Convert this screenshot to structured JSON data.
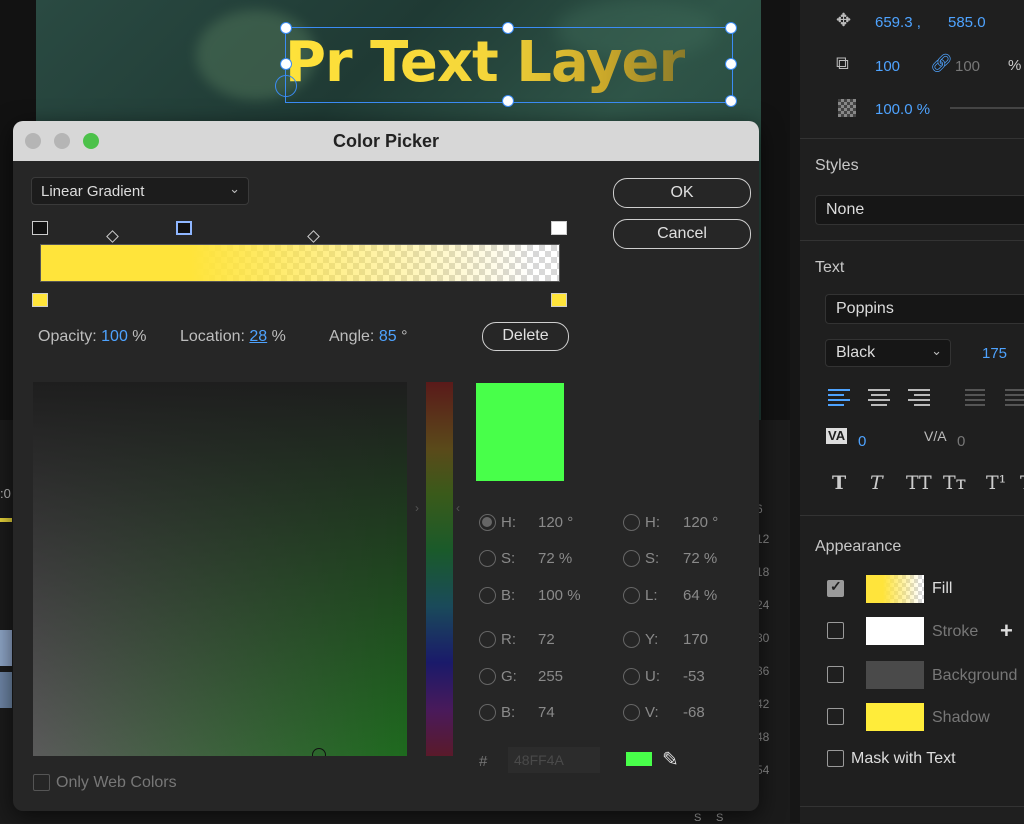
{
  "monitor": {
    "title_text": "Pr Text Layer",
    "timeline_ticks": [
      "6",
      "12",
      "18",
      "24",
      "30",
      "36",
      "42",
      "48",
      "54"
    ],
    "timecode_fragment": ":0",
    "s_labels": [
      "S",
      "S"
    ]
  },
  "right_panel": {
    "position_x": "659.3 ,",
    "position_y": "585.0",
    "scale": "100",
    "scale_link": "100",
    "scale_unit": "%",
    "opacity": "100.0 %",
    "styles_heading": "Styles",
    "styles_value": "None",
    "text_heading": "Text",
    "font": "Poppins",
    "font_style": "Black",
    "font_size": "175",
    "kerning": "0",
    "tracking": "0",
    "text_styles": [
      "T",
      "T",
      "TT",
      "Tт",
      "T¹",
      "T"
    ],
    "appearance_heading": "Appearance",
    "fill_label": "Fill",
    "stroke_label": "Stroke",
    "background_label": "Background",
    "shadow_label": "Shadow",
    "mask_label": "Mask with Text"
  },
  "dialog": {
    "title": "Color Picker",
    "gradient_type": "Linear Gradient",
    "ok_label": "OK",
    "cancel_label": "Cancel",
    "opacity_label": "Opacity:",
    "opacity_value": "100",
    "opacity_unit": "%",
    "location_label": "Location:",
    "location_value": "28",
    "location_unit": "%",
    "angle_label": "Angle:",
    "angle_value": "85",
    "angle_unit": "°",
    "delete_label": "Delete",
    "only_web_colors": "Only Web Colors",
    "hash": "#",
    "hex_value": "48FF4A",
    "new_color": "#48ff4a",
    "gradient_color": "#ffe43b",
    "fields_left": [
      {
        "label": "H:",
        "value": "120 °"
      },
      {
        "label": "S:",
        "value": "72 %"
      },
      {
        "label": "B:",
        "value": "100 %"
      },
      {
        "label": "R:",
        "value": "72"
      },
      {
        "label": "G:",
        "value": "255"
      },
      {
        "label": "B:",
        "value": "74"
      }
    ],
    "fields_right": [
      {
        "label": "H:",
        "value": "120 °"
      },
      {
        "label": "S:",
        "value": "72 %"
      },
      {
        "label": "L:",
        "value": "64 %"
      },
      {
        "label": "Y:",
        "value": "170"
      },
      {
        "label": "U:",
        "value": "-53"
      },
      {
        "label": "V:",
        "value": "-68"
      }
    ]
  }
}
